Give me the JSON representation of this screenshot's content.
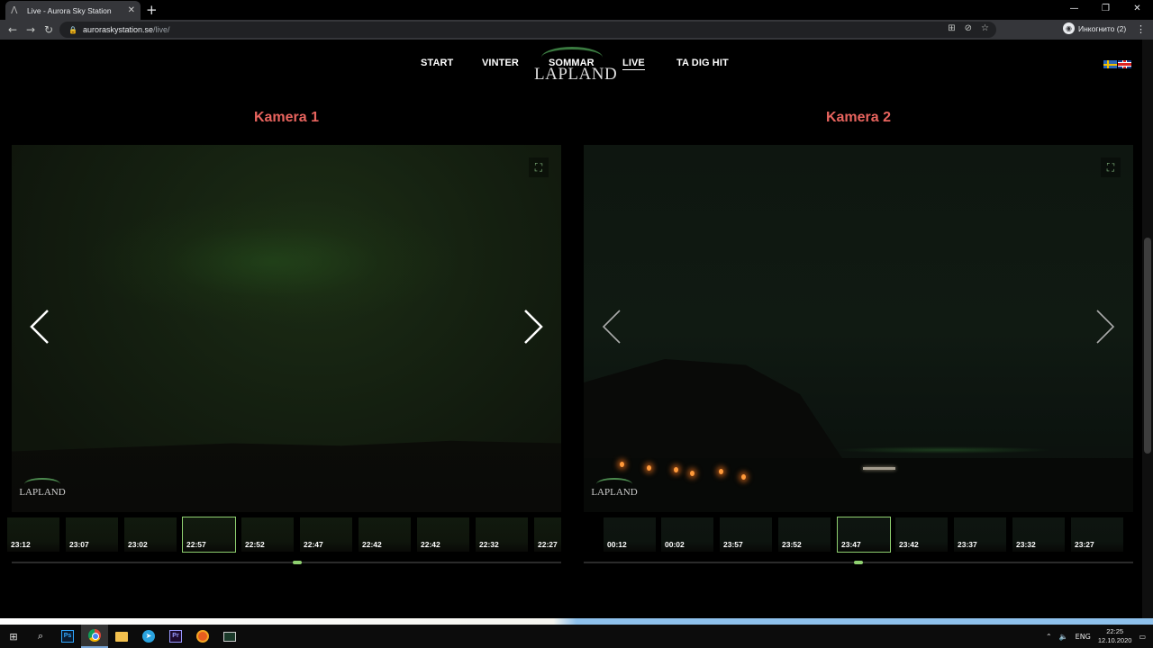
{
  "browser": {
    "tab_title": "Live - Aurora Sky Station",
    "tab_favicon": "aurora-favicon-icon",
    "url_host": "auroraskystation.se",
    "url_path": "/live/",
    "incognito_label": "Инкогнито (2)"
  },
  "nav": {
    "items": [
      "START",
      "VINTER",
      "SOMMAR",
      "LIVE",
      "TA DIG HIT"
    ],
    "active": "LIVE",
    "logo_text": "LAPLAND"
  },
  "cameras": [
    {
      "title": "Kamera 1",
      "watermark": "LAPLAND",
      "thumbs": [
        "23:12",
        "23:07",
        "23:02",
        "22:57",
        "22:52",
        "22:47",
        "22:42",
        "22:42",
        "22:32",
        "22:27"
      ],
      "selected_index": 3,
      "timeline_position": 0.52
    },
    {
      "title": "Kamera 2",
      "watermark": "LAPLAND",
      "thumbs": [
        "00:12",
        "00:02",
        "23:57",
        "23:52",
        "23:47",
        "23:42",
        "23:37",
        "23:32",
        "23:27"
      ],
      "selected_index": 4,
      "timeline_position": 0.5
    }
  ],
  "taskbar": {
    "language": "ENG",
    "time": "22:25",
    "date": "12.10.2020",
    "apps": [
      "windows-start-icon",
      "search-icon",
      "photoshop-icon",
      "chrome-icon",
      "file-explorer-icon",
      "telegram-icon",
      "premiere-icon",
      "orange-app-icon",
      "screen-app-icon"
    ]
  },
  "colors": {
    "camera_title": "#e8645e",
    "accent_green": "#8fd070"
  }
}
